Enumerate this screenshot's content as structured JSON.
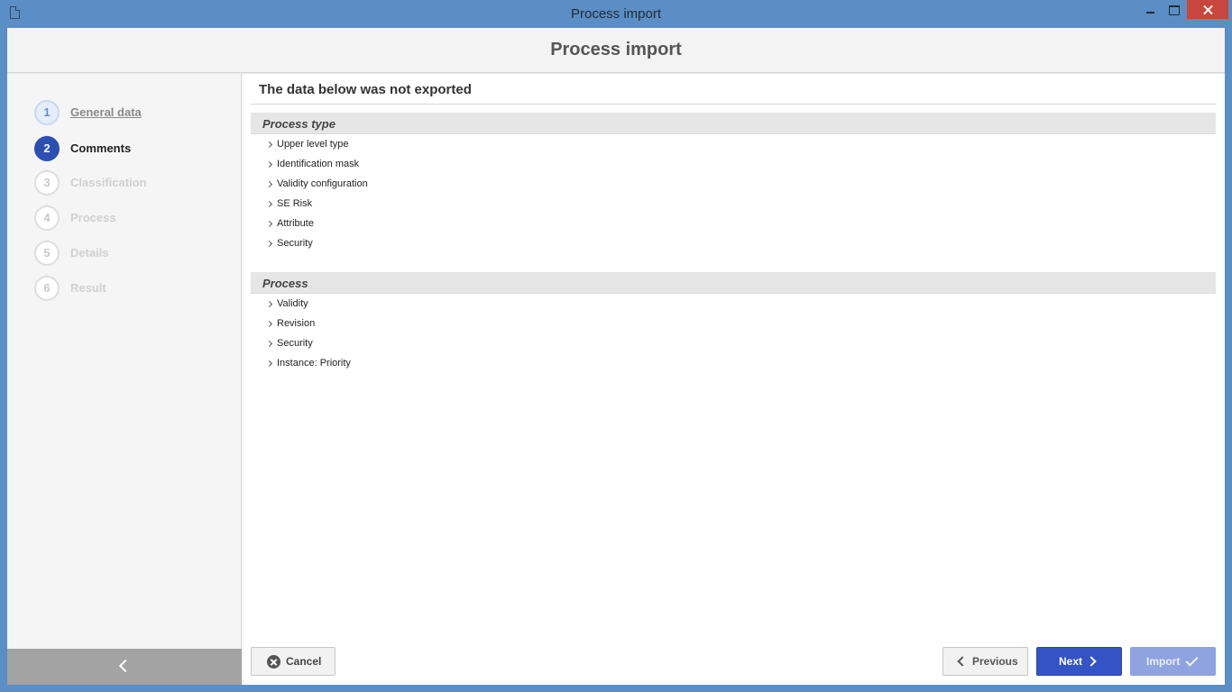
{
  "window": {
    "title": "Process import"
  },
  "header": {
    "title": "Process import"
  },
  "steps": [
    {
      "number": "1",
      "label": "General data",
      "state": "done"
    },
    {
      "number": "2",
      "label": "Comments",
      "state": "active"
    },
    {
      "number": "3",
      "label": "Classification",
      "state": "pending"
    },
    {
      "number": "4",
      "label": "Process",
      "state": "pending"
    },
    {
      "number": "5",
      "label": "Details",
      "state": "pending"
    },
    {
      "number": "6",
      "label": "Result",
      "state": "pending"
    }
  ],
  "main": {
    "heading": "The data below was not exported",
    "sections": [
      {
        "title": "Process type",
        "items": [
          "Upper level type",
          "Identification mask",
          "Validity configuration",
          "SE Risk",
          "Attribute",
          "Security"
        ]
      },
      {
        "title": "Process",
        "items": [
          "Validity",
          "Revision",
          "Security",
          "Instance: Priority"
        ]
      }
    ]
  },
  "footer": {
    "cancel_label": "Cancel",
    "previous_label": "Previous",
    "next_label": "Next",
    "import_label": "Import"
  },
  "colors": {
    "accent": "#3453c4",
    "titlebar": "#5b8ec4",
    "close": "#c7463d"
  }
}
